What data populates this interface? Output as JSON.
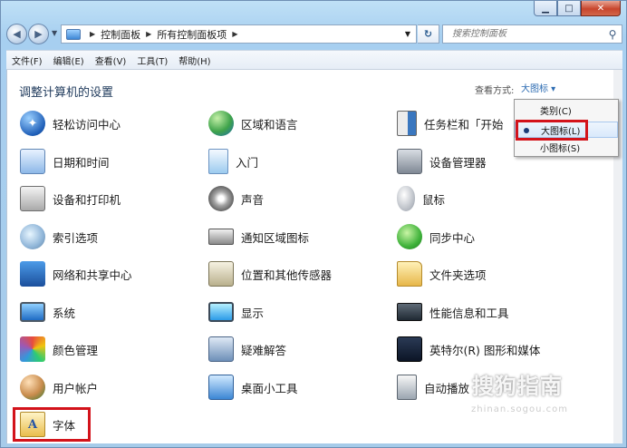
{
  "address": {
    "crumbs": [
      "控制面板",
      "所有控制面板项"
    ]
  },
  "search": {
    "placeholder": "搜索控制面板"
  },
  "menubar": [
    "文件(F)",
    "编辑(E)",
    "查看(V)",
    "工具(T)",
    "帮助(H)"
  ],
  "page": {
    "title": "调整计算机的设置",
    "view_by_label": "查看方式:",
    "view_by_value": "大图标 ▾"
  },
  "view_menu": {
    "options": [
      "类别(C)",
      "大图标(L)",
      "小图标(S)"
    ],
    "selected": "大图标(L)"
  },
  "items": [
    {
      "label": "轻松访问中心",
      "icon": "ease-of-access-icon"
    },
    {
      "label": "区域和语言",
      "icon": "globe-clock-icon"
    },
    {
      "label": "任务栏和「开始",
      "icon": "taskbar-icon"
    },
    {
      "label": "日期和时间",
      "icon": "calendar-clock-icon"
    },
    {
      "label": "入门",
      "icon": "getting-started-icon"
    },
    {
      "label": "设备管理器",
      "icon": "device-manager-icon"
    },
    {
      "label": "设备和打印机",
      "icon": "printer-icon"
    },
    {
      "label": "声音",
      "icon": "speaker-icon"
    },
    {
      "label": "鼠标",
      "icon": "mouse-icon"
    },
    {
      "label": "索引选项",
      "icon": "indexing-icon"
    },
    {
      "label": "通知区域图标",
      "icon": "notification-tray-icon"
    },
    {
      "label": "同步中心",
      "icon": "sync-icon"
    },
    {
      "label": "网络和共享中心",
      "icon": "network-icon"
    },
    {
      "label": "位置和其他传感器",
      "icon": "sensor-icon"
    },
    {
      "label": "文件夹选项",
      "icon": "folder-options-icon"
    },
    {
      "label": "系统",
      "icon": "system-monitor-icon"
    },
    {
      "label": "显示",
      "icon": "display-icon"
    },
    {
      "label": "性能信息和工具",
      "icon": "performance-icon"
    },
    {
      "label": "颜色管理",
      "icon": "color-management-icon"
    },
    {
      "label": "疑难解答",
      "icon": "troubleshooting-icon"
    },
    {
      "label": "英特尔(R) 图形和媒体",
      "icon": "intel-graphics-icon"
    },
    {
      "label": "用户帐户",
      "icon": "user-accounts-icon"
    },
    {
      "label": "桌面小工具",
      "icon": "gadgets-icon"
    },
    {
      "label": "自动播放",
      "icon": "autoplay-icon"
    },
    {
      "label": "字体",
      "icon": "fonts-icon"
    }
  ],
  "watermark": {
    "main": "搜狗指南",
    "sub": "zhinan.sogou.com"
  },
  "colors": {
    "highlight": "#d3131b",
    "title_text": "#1e395b",
    "link": "#2c6bb2"
  }
}
